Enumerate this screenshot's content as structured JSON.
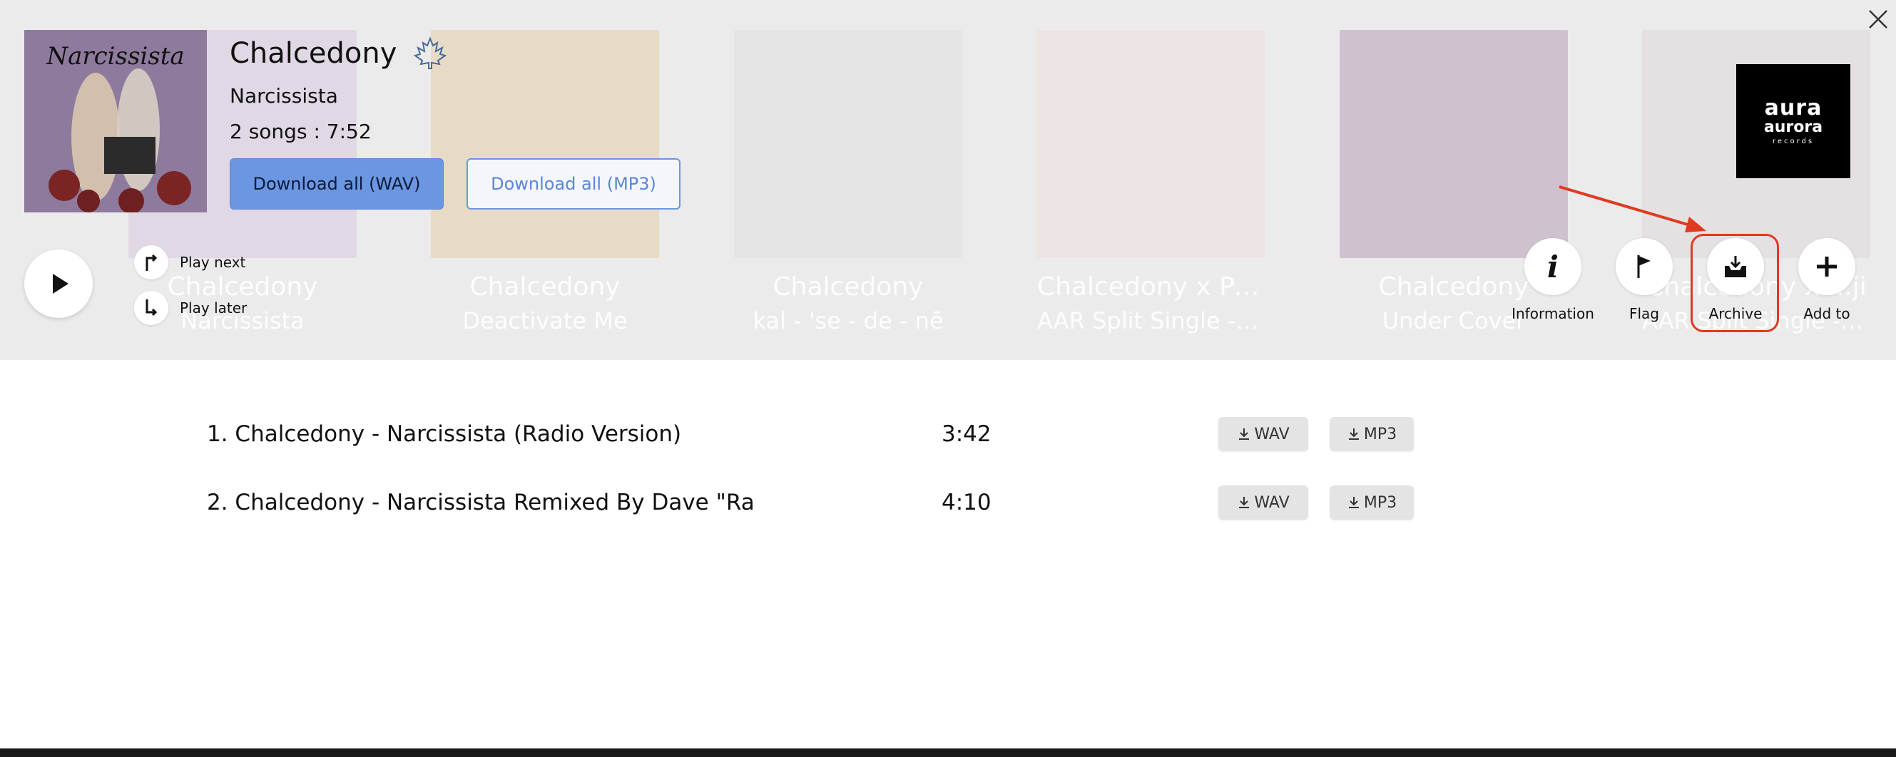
{
  "header": {
    "artist": "Chalcedony",
    "album": "Narcissista",
    "songs_info": "2 songs : 7:52",
    "download_wav_label": "Download all (WAV)",
    "download_mp3_label": "Download all (MP3)",
    "play_next_label": "Play next",
    "play_later_label": "Play later",
    "cover_text": "Narcissista",
    "label_logo": {
      "line1": "aura",
      "line2": "aurora",
      "line3": "records"
    }
  },
  "background_albums": [
    {
      "title": "Chalcedony",
      "subtitle": "Narcissista",
      "color": "#c9a8d8"
    },
    {
      "title": "Chalcedony",
      "subtitle": "Deactivate Me",
      "color": "#e2b565"
    },
    {
      "title": "Chalcedony",
      "subtitle": "kal - 'se - de - nē",
      "color": "#d8d8d8"
    },
    {
      "title": "Chalcedony x Pet...",
      "subtitle": "AAR Split Single - D...",
      "color": "#f2d3cf"
    },
    {
      "title": "Chalcedony",
      "subtitle": "Under Cover",
      "color": "#8a5a8a"
    },
    {
      "title": "Chalcedony x ...ji",
      "subtitle": "AAR Split Single - R...",
      "color": "#d8c8d0"
    }
  ],
  "actions": [
    {
      "label": "Information",
      "icon": "info-icon"
    },
    {
      "label": "Flag",
      "icon": "flag-icon"
    },
    {
      "label": "Archive",
      "icon": "archive-icon"
    },
    {
      "label": "Add to",
      "icon": "plus-icon"
    }
  ],
  "tracks": [
    {
      "title": "1. Chalcedony - Narcissista (Radio Version)",
      "duration": "3:42",
      "wav": "WAV",
      "mp3": "MP3"
    },
    {
      "title": "2. Chalcedony - Narcissista Remixed By Dave \"Ra",
      "duration": "4:10",
      "wav": "WAV",
      "mp3": "MP3"
    }
  ],
  "colors": {
    "accent": "#6b96e2",
    "header_bg": "#ebebeb",
    "highlight": "#e03a1e"
  }
}
